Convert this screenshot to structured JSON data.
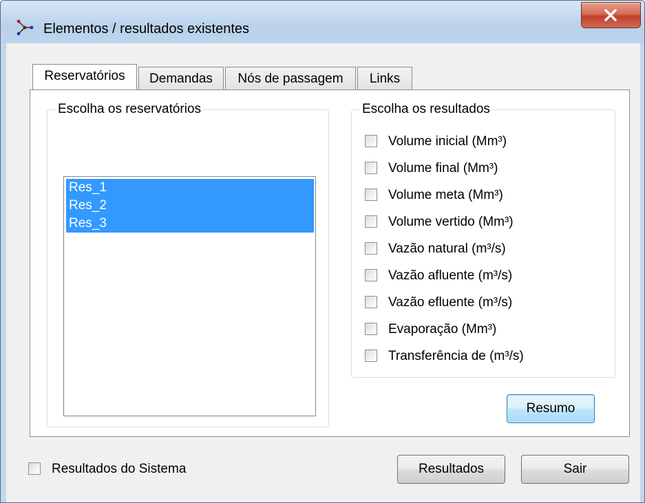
{
  "window": {
    "title": "Elementos / resultados existentes"
  },
  "icons": {
    "app": "network-nodes-icon",
    "close": "close-icon"
  },
  "tabs": [
    {
      "label": "Reservatórios",
      "active": true
    },
    {
      "label": "Demandas",
      "active": false
    },
    {
      "label": "Nós de passagem",
      "active": false
    },
    {
      "label": "Links",
      "active": false
    }
  ],
  "reservoirs_group": {
    "label": "Escolha os reservatórios",
    "items": [
      {
        "label": "Res_1",
        "selected": true
      },
      {
        "label": "Res_2",
        "selected": true
      },
      {
        "label": "Res_3",
        "selected": true
      }
    ]
  },
  "results_group": {
    "label": "Escolha os resultados",
    "options": [
      {
        "label": "Volume inicial (Mm³)",
        "checked": false
      },
      {
        "label": "Volume final (Mm³)",
        "checked": false
      },
      {
        "label": "Volume meta (Mm³)",
        "checked": false
      },
      {
        "label": "Volume vertido (Mm³)",
        "checked": false
      },
      {
        "label": "Vazão natural (m³/s)",
        "checked": false
      },
      {
        "label": "Vazão afluente (m³/s)",
        "checked": false
      },
      {
        "label": "Vazão efluente (m³/s)",
        "checked": false
      },
      {
        "label": "Evaporação (Mm³)",
        "checked": false
      },
      {
        "label": "Transferência de (m³/s)",
        "checked": false
      }
    ]
  },
  "buttons": {
    "summary": "Resumo",
    "results": "Resultados",
    "exit": "Sair"
  },
  "system_results": {
    "label": "Resultados do Sistema",
    "checked": false
  },
  "colors": {
    "selection": "#3399ff",
    "titlebar": "#c6dbf0",
    "close_button": "#c75a45"
  }
}
